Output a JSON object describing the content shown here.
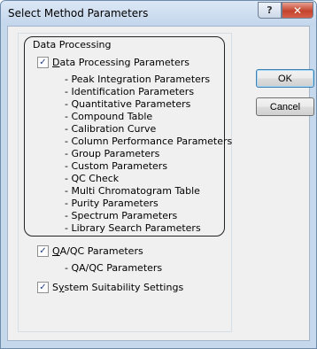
{
  "window": {
    "title": "Select Method Parameters",
    "help_glyph": "?",
    "close_glyph": "✕"
  },
  "data_processing": {
    "group_label": "Data Processing",
    "checkbox": {
      "label_first": "D",
      "label_rest": "ata Processing Parameters",
      "checked": true
    },
    "items": [
      "- Peak Integration Parameters",
      "- Identification Parameters",
      "- Quantitative Parameters",
      "- Compound Table",
      "- Calibration Curve",
      "- Column Performance Parameters",
      "- Group Parameters",
      "- Custom Parameters",
      "- QC Check",
      "- Multi Chromatogram Table",
      "- Purity Parameters",
      "- Spectrum Parameters",
      "- Library Search Parameters"
    ]
  },
  "qaqc": {
    "checkbox": {
      "label_first": "Q",
      "label_rest": "A/QC Parameters",
      "checked": true
    },
    "items": [
      "- QA/QC Parameters"
    ]
  },
  "system_suitability": {
    "checkbox": {
      "label_prefix": "S",
      "label_mnemonic": "y",
      "label_rest": "stem Suitability Settings",
      "checked": true
    }
  },
  "buttons": {
    "ok": "OK",
    "cancel": "Cancel"
  },
  "check_glyph": "✓"
}
